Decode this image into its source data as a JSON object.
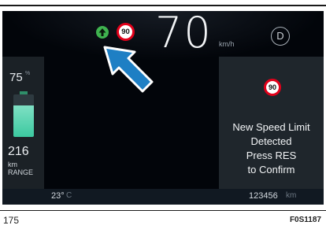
{
  "header": {
    "speed_value": "70",
    "speed_unit": "km/h",
    "gear": "D",
    "detected_limit": "90"
  },
  "battery": {
    "percent_value": "75",
    "percent_unit": "%",
    "fill_fraction": 0.75,
    "fill_color": "#3cc9a0",
    "range_value": "216",
    "range_unit": "km",
    "range_label": "RANGE"
  },
  "popup": {
    "limit": "90",
    "lines": [
      "New Speed Limit",
      "Detected",
      "Press RES",
      "to Confirm"
    ]
  },
  "status_bar": {
    "temperature_value": "23°",
    "temperature_unit": "C",
    "odometer_value": "123456",
    "odometer_unit": "km"
  },
  "footer": {
    "page_number": "175",
    "figure_id": "F0S1187"
  },
  "colors": {
    "limit_ring": "#e2001a",
    "acc_icon": "#3fb34f",
    "callout_arrow": "#1e7fc4"
  },
  "icons": [
    "acc-speed-icon",
    "callout-arrow-icon",
    "speed-limit-sign-icon"
  ]
}
